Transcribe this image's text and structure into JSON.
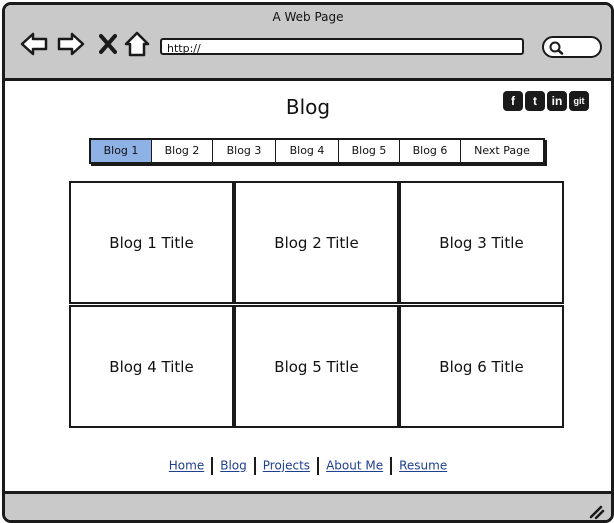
{
  "window": {
    "title": "A Web Page"
  },
  "toolbar": {
    "icons": [
      "back-arrow-icon",
      "forward-arrow-icon",
      "close-x-icon",
      "home-icon",
      "search-icon"
    ],
    "url": "http://"
  },
  "page": {
    "title": "Blog"
  },
  "social": [
    {
      "name": "facebook-icon",
      "glyph": "f"
    },
    {
      "name": "twitter-icon",
      "glyph": "t"
    },
    {
      "name": "linkedin-icon",
      "glyph": "in"
    },
    {
      "name": "git-icon",
      "glyph": "git"
    }
  ],
  "pagination": {
    "tabs": [
      "Blog 1",
      "Blog 2",
      "Blog 3",
      "Blog 4",
      "Blog 5",
      "Blog 6",
      "Next Page"
    ],
    "active_index": 0
  },
  "posts": [
    {
      "title": "Blog 1 Title"
    },
    {
      "title": "Blog 2 Title"
    },
    {
      "title": "Blog 3 Title"
    },
    {
      "title": "Blog 4 Title"
    },
    {
      "title": "Blog 5 Title"
    },
    {
      "title": "Blog 6 Title"
    }
  ],
  "footer": {
    "links": [
      "Home",
      "Blog",
      "Projects",
      "About Me",
      "Resume"
    ]
  },
  "colors": {
    "chrome": "#c9c9c9",
    "active_tab": "#8fb2e6",
    "link": "#1f3f8f"
  }
}
